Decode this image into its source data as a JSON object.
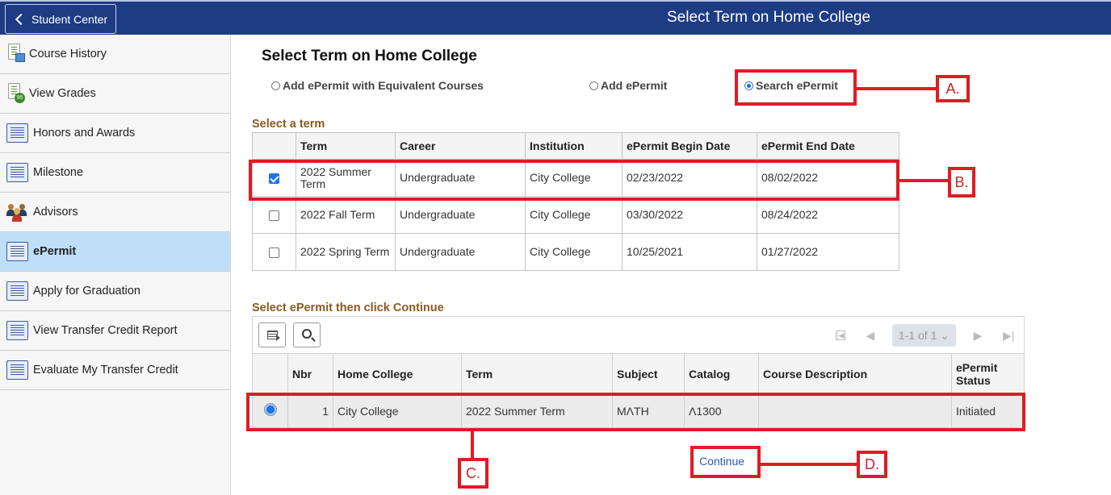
{
  "header": {
    "back_label": "Student Center",
    "title": "Select Term on Home College"
  },
  "sidebar": {
    "items": [
      {
        "label": "Course History",
        "icon": "course-history-icon"
      },
      {
        "label": "View Grades",
        "icon": "grades-icon",
        "badge": "95"
      },
      {
        "label": "Honors and Awards",
        "icon": "list-icon"
      },
      {
        "label": "Milestone",
        "icon": "list-icon"
      },
      {
        "label": "Advisors",
        "icon": "people-icon"
      },
      {
        "label": "ePermit",
        "icon": "list-icon",
        "active": true
      },
      {
        "label": "Apply for Graduation",
        "icon": "list-icon"
      },
      {
        "label": "View Transfer Credit Report",
        "icon": "list-icon"
      },
      {
        "label": "Evaluate My Transfer Credit",
        "icon": "list-icon"
      }
    ]
  },
  "main": {
    "title": "Select Term on Home College",
    "options": [
      {
        "label": "Add ePermit with Equivalent Courses",
        "selected": false
      },
      {
        "label": "Add ePermit",
        "selected": false
      },
      {
        "label": "Search ePermit",
        "selected": true
      }
    ],
    "terms_section": "Select a term",
    "terms_columns": [
      "",
      "Term",
      "Career",
      "Institution",
      "ePermit Begin Date",
      "ePermit End Date"
    ],
    "terms_rows": [
      {
        "checked": true,
        "term": "2022 Summer Term",
        "career": "Undergraduate",
        "institution": "City College",
        "begin": "02/23/2022",
        "end": "08/02/2022"
      },
      {
        "checked": false,
        "term": "2022 Fall Term",
        "career": "Undergraduate",
        "institution": "City College",
        "begin": "03/30/2022",
        "end": "08/24/2022"
      },
      {
        "checked": false,
        "term": "2022 Spring Term",
        "career": "Undergraduate",
        "institution": "City College",
        "begin": "10/25/2021",
        "end": "01/27/2022"
      }
    ],
    "permits_section": "Select ePermit then click Continue",
    "pager": {
      "range": "1-1 of 1"
    },
    "permits_columns": [
      "",
      "Nbr",
      "Home College",
      "Term",
      "Subject",
      "Catalog",
      "Course Description",
      "ePermit Status"
    ],
    "permits_rows": [
      {
        "selected": true,
        "nbr": "1",
        "home_college": "City College",
        "term": "2022 Summer Term",
        "subject": "MΛTH",
        "catalog": "Λ1300",
        "description": "",
        "status": "Initiated"
      }
    ],
    "continue_label": "Continue"
  },
  "annotations": {
    "a": "A.",
    "b": "B.",
    "c": "C.",
    "d": "D."
  },
  "colors": {
    "header_bg": "#1e3c84",
    "active_item": "#bfdff9",
    "section_label": "#8a5a1e",
    "annotation": "#e01b24",
    "link": "#2a5caa"
  }
}
